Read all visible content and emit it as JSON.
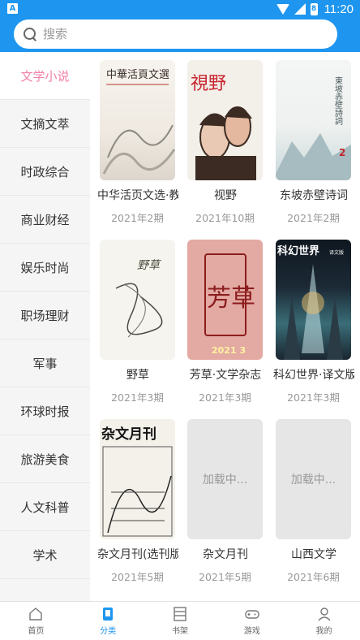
{
  "status_bar": {
    "app_letter": "A",
    "battery_glyph": "8",
    "time": "11:20"
  },
  "search": {
    "placeholder": "搜索"
  },
  "categories": [
    {
      "label": "文学小说",
      "active": true
    },
    {
      "label": "文摘文萃"
    },
    {
      "label": "时政综合"
    },
    {
      "label": "商业财经"
    },
    {
      "label": "娱乐时尚"
    },
    {
      "label": "职场理财"
    },
    {
      "label": "军事"
    },
    {
      "label": "环球时报"
    },
    {
      "label": "旅游美食"
    },
    {
      "label": "人文科普"
    },
    {
      "label": "学术"
    }
  ],
  "books": [
    {
      "title": "中华活页文选·教",
      "issue": "2021年2期",
      "cover_text": "中華活頁文選",
      "cover_sub": ""
    },
    {
      "title": "视野",
      "issue": "2021年10期",
      "cover_text": "視野",
      "cover_sub": ""
    },
    {
      "title": "东坡赤壁诗词",
      "issue": "2021年2期",
      "cover_text": "東坡赤壁詩詞",
      "cover_sub": "2"
    },
    {
      "title": "野草",
      "issue": "2021年3期",
      "cover_text": "野草",
      "cover_sub": ""
    },
    {
      "title": "芳草·文学杂志",
      "issue": "2021年3期",
      "cover_text": "芳草",
      "cover_sub": "2021 3"
    },
    {
      "title": "科幻世界·译文版",
      "issue": "2021年3期",
      "cover_text": "科幻世界",
      "cover_sub": "译文版"
    },
    {
      "title": "杂文月刊(选刊版",
      "issue": "2021年5期",
      "cover_text": "杂文月刊",
      "cover_sub": ""
    },
    {
      "title": "杂文月刊",
      "issue": "2021年5期",
      "loading": "加载中..."
    },
    {
      "title": "山西文学",
      "issue": "2021年6期",
      "loading": "加载中..."
    }
  ],
  "bottom_nav": [
    {
      "label": "首页",
      "icon": "home-icon"
    },
    {
      "label": "分类",
      "icon": "category-icon",
      "active": true
    },
    {
      "label": "书架",
      "icon": "bookshelf-icon"
    },
    {
      "label": "游戏",
      "icon": "gamepad-icon"
    },
    {
      "label": "我的",
      "icon": "user-icon"
    }
  ],
  "colors": {
    "accent": "#1e96f0",
    "active_category": "#f07fa8"
  }
}
